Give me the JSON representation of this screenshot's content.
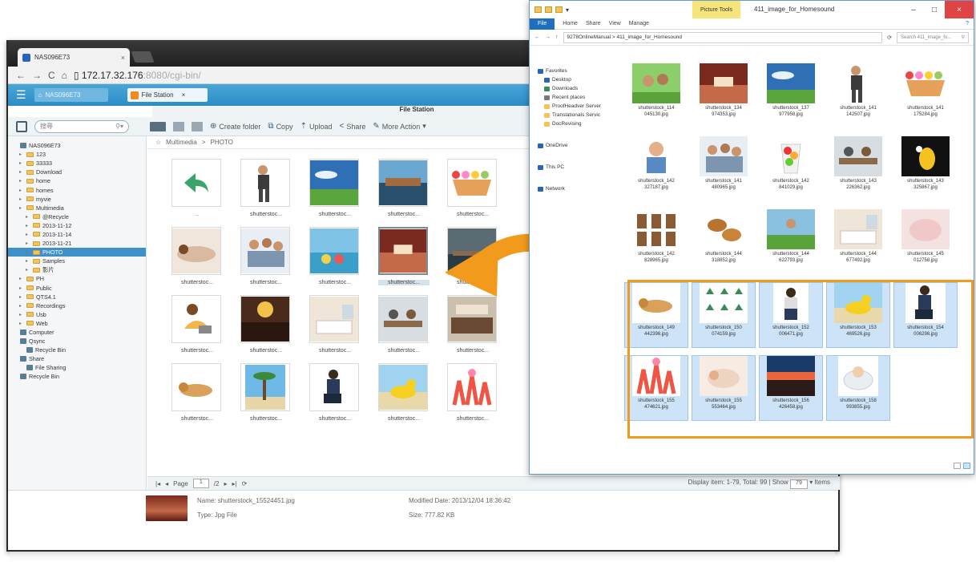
{
  "browser": {
    "tab_title": "NAS096E73",
    "url_main": "172.17.32.176",
    "url_rest": ":8080/cgi-bin/"
  },
  "qts": {
    "home_label": "NAS096E73",
    "app_tab": "File Station",
    "title": "File Station",
    "search_placeholder": "搜尋",
    "toolbar": {
      "create_folder": "Create folder",
      "copy": "Copy",
      "upload": "Upload",
      "share": "Share",
      "more_action": "More Action"
    },
    "breadcrumb": {
      "root": "Multimedia",
      "sep": ">",
      "current": "PHOTO"
    },
    "tree": [
      {
        "label": "NAS096E73",
        "level": 0,
        "icon": "server-icon"
      },
      {
        "label": "123",
        "level": 1
      },
      {
        "label": "33333",
        "level": 1
      },
      {
        "label": "Download",
        "level": 1
      },
      {
        "label": "home",
        "level": 1
      },
      {
        "label": "homes",
        "level": 1
      },
      {
        "label": "myvie",
        "level": 1
      },
      {
        "label": "Multimedia",
        "level": 1
      },
      {
        "label": "@Recycle",
        "level": 2
      },
      {
        "label": "2013-11-12",
        "level": 2
      },
      {
        "label": "2013-11-14",
        "level": 2
      },
      {
        "label": "2013-11-21",
        "level": 2
      },
      {
        "label": "PHOTO",
        "level": 2,
        "selected": true
      },
      {
        "label": "Samples",
        "level": 2
      },
      {
        "label": "影片",
        "level": 2
      },
      {
        "label": "PH",
        "level": 1
      },
      {
        "label": "Public",
        "level": 1
      },
      {
        "label": "QTS4.1",
        "level": 1
      },
      {
        "label": "Recordings",
        "level": 1
      },
      {
        "label": "Usb",
        "level": 1
      },
      {
        "label": "Web",
        "level": 1
      },
      {
        "label": "Computer",
        "level": 0,
        "icon": "computer-icon"
      },
      {
        "label": "Qsync",
        "level": 0,
        "icon": "qsync-icon"
      },
      {
        "label": "Recycle Bin",
        "level": 1,
        "icon": "recycle-icon"
      },
      {
        "label": "Share",
        "level": 0,
        "icon": "share-icon"
      },
      {
        "label": "File Sharing",
        "level": 1,
        "icon": "file-sharing-icon"
      },
      {
        "label": "Recycle Bin",
        "level": 0,
        "icon": "recycle-icon"
      }
    ],
    "grid": [
      {
        "label": "..",
        "kind": "up"
      },
      {
        "label": "shutterstoc...",
        "kind": "man"
      },
      {
        "label": "shutterstoc...",
        "kind": "sky"
      },
      {
        "label": "shutterstoc...",
        "kind": "sea"
      },
      {
        "label": "shutterstoc...",
        "kind": "icecream"
      },
      {
        "label": "shutterstoc...",
        "kind": "spa"
      },
      {
        "label": "shutterstoc...",
        "kind": "people"
      },
      {
        "label": "shutterstoc...",
        "kind": "beach"
      },
      {
        "label": "shutterstoc...",
        "kind": "room",
        "selected": true
      },
      {
        "label": "shutterstoc...",
        "kind": "dock"
      },
      {
        "label": "shutterstoc...",
        "kind": "girl"
      },
      {
        "label": "shutterstoc...",
        "kind": "crowd"
      },
      {
        "label": "shutterstoc...",
        "kind": "bedroom"
      },
      {
        "label": "shutterstoc...",
        "kind": "office"
      },
      {
        "label": "shutterstoc...",
        "kind": "cafe"
      },
      {
        "label": "shutterstoc...",
        "kind": "dog"
      },
      {
        "label": "shutterstoc...",
        "kind": "palm"
      },
      {
        "label": "shutterstoc...",
        "kind": "photographer"
      },
      {
        "label": "shutterstoc...",
        "kind": "duck"
      },
      {
        "label": "shutterstoc...",
        "kind": "dance"
      }
    ],
    "pager": {
      "page_label": "Page",
      "page_value": "1",
      "page_total": "/2",
      "display_text": "Display item: 1-79, Total: 99 | Show",
      "show_value": "79",
      "items_label": "Items"
    },
    "info": {
      "name": "Name:  shutterstock_15524451.jpg",
      "type": "Type:  Jpg File",
      "modified": "Modified Date:  2013/12/04 18:36:42",
      "size": "Size:  777.82 KB"
    }
  },
  "explorer": {
    "context_tab": "Picture Tools",
    "window_title": "411_image_for_Homesound",
    "ribbon": [
      "File",
      "Home",
      "Share",
      "View",
      "Manage"
    ],
    "path": "9278OnlineManual  >  411_image_for_Homesound",
    "search_placeholder": "Search 411_image_fo...",
    "nav": [
      {
        "label": "Favorites",
        "kind": "head"
      },
      {
        "label": "Desktop",
        "kind": "sub"
      },
      {
        "label": "Downloads",
        "kind": "sub"
      },
      {
        "label": "Recent places",
        "kind": "sub"
      },
      {
        "label": "ProofHeadver Server",
        "kind": "sub"
      },
      {
        "label": "Translationals Servic",
        "kind": "sub"
      },
      {
        "label": "DocRevising",
        "kind": "sub"
      },
      {
        "label": "",
        "kind": "gap"
      },
      {
        "label": "OneDrive",
        "kind": "head"
      },
      {
        "label": "",
        "kind": "gap"
      },
      {
        "label": "This PC",
        "kind": "head"
      },
      {
        "label": "",
        "kind": "gap"
      },
      {
        "label": "Network",
        "kind": "head"
      }
    ],
    "items": [
      {
        "line1": "shutterstock_114",
        "line2": "045130.jpg",
        "kind": "family"
      },
      {
        "line1": "shutterstock_134",
        "line2": "974353.jpg",
        "kind": "room"
      },
      {
        "line1": "shutterstock_137",
        "line2": "977958.jpg",
        "kind": "sky"
      },
      {
        "line1": "shutterstock_141",
        "line2": "142507.jpg",
        "kind": "man"
      },
      {
        "line1": "shutterstock_141",
        "line2": "175284.jpg",
        "kind": "icecream"
      },
      {
        "line1": "shutterstock_142",
        "line2": "327187.jpg",
        "kind": "thumbsup"
      },
      {
        "line1": "shutterstock_141",
        "line2": "480965.jpg",
        "kind": "people"
      },
      {
        "line1": "shutterstock_142",
        "line2": "841029.jpg",
        "kind": "fruit"
      },
      {
        "line1": "shutterstock_143",
        "line2": "226362.jpg",
        "kind": "office"
      },
      {
        "line1": "shutterstock_143",
        "line2": "325867.jpg",
        "kind": "bird"
      },
      {
        "line1": "shutterstock_142",
        "line2": "828965.jpg",
        "kind": "chairs"
      },
      {
        "line1": "shutterstock_144",
        "line2": "318852.jpg",
        "kind": "food"
      },
      {
        "line1": "shutterstock_144",
        "line2": "622793.jpg",
        "kind": "kid"
      },
      {
        "line1": "shutterstock_144",
        "line2": "677492.jpg",
        "kind": "bedroom"
      },
      {
        "line1": "shutterstock_145",
        "line2": "012758.jpg",
        "kind": "pink"
      },
      {
        "line1": "shutterstock_149",
        "line2": "442396.jpg",
        "kind": "dog",
        "selected": true
      },
      {
        "line1": "shutterstock_150",
        "line2": "074159.jpg",
        "kind": "lamps",
        "selected": true
      },
      {
        "line1": "shutterstock_152",
        "line2": "006471.jpg",
        "kind": "sitting",
        "selected": true
      },
      {
        "line1": "shutterstock_153",
        "line2": "469526.jpg",
        "kind": "duck",
        "selected": true
      },
      {
        "line1": "shutterstock_154",
        "line2": "006296.jpg",
        "kind": "photographer",
        "selected": true
      },
      {
        "line1": "shutterstock_155",
        "line2": "474621.jpg",
        "kind": "dance",
        "selected": true
      },
      {
        "line1": "shutterstock_155",
        "line2": "553464.jpg",
        "kind": "baby",
        "selected": true
      },
      {
        "line1": "shutterstock_156",
        "line2": "426458.jpg",
        "kind": "sunset",
        "selected": true
      },
      {
        "line1": "shutterstock_158",
        "line2": "993855.jpg",
        "kind": "babybath",
        "selected": true
      }
    ]
  },
  "colors": {
    "qts_blue": "#2c8cc4",
    "highlight_orange": "#f29a1c",
    "selection_blue": "#cde3f7"
  }
}
